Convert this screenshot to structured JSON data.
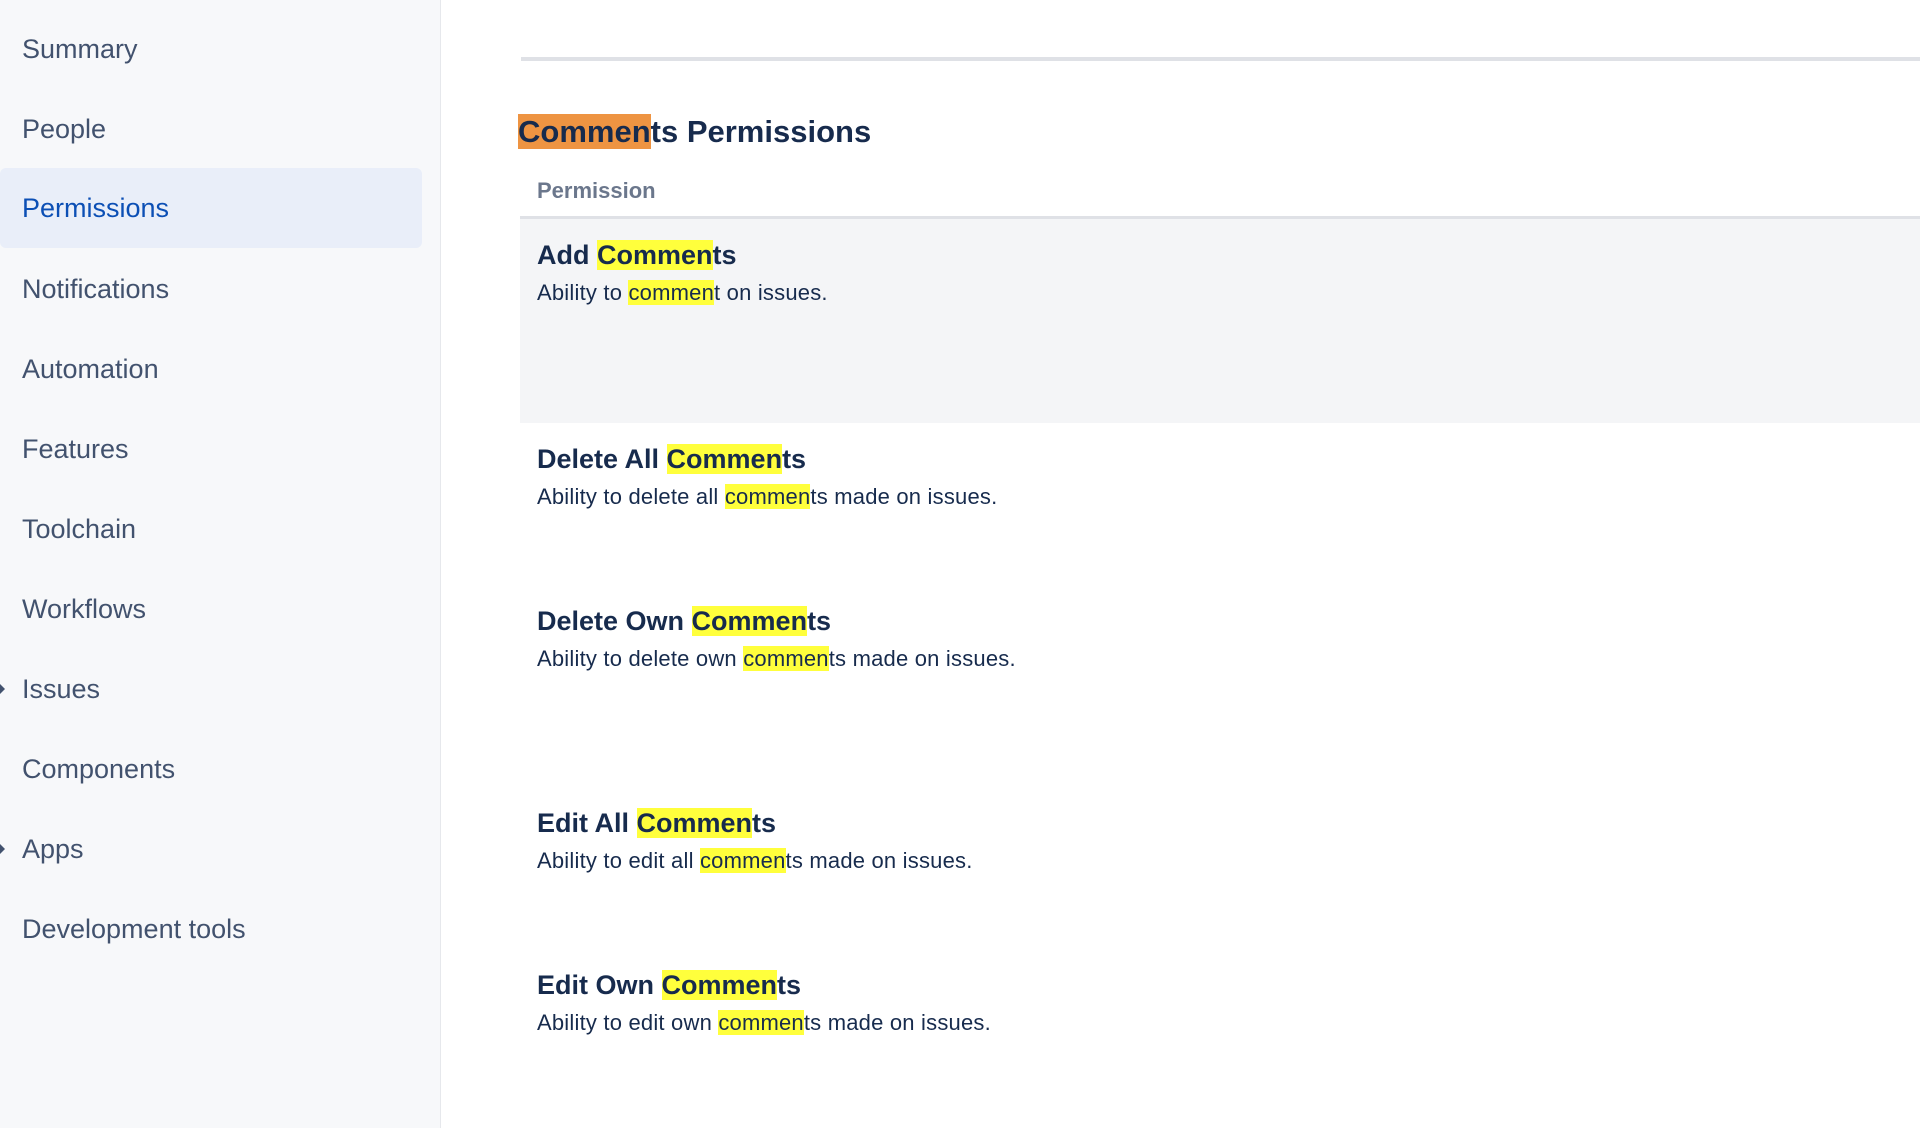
{
  "sidebar": {
    "items": [
      {
        "label": "Summary"
      },
      {
        "label": "People"
      },
      {
        "label": "Permissions",
        "active": true
      },
      {
        "label": "Notifications"
      },
      {
        "label": "Automation"
      },
      {
        "label": "Features"
      },
      {
        "label": "Toolchain"
      },
      {
        "label": "Workflows"
      },
      {
        "label": "Issues",
        "expandable": true
      },
      {
        "label": "Components"
      },
      {
        "label": "Apps",
        "expandable": true
      },
      {
        "label": "Development tools"
      }
    ]
  },
  "main": {
    "section": {
      "title_match": "Commen",
      "title_rest": "ts Permissions"
    },
    "table": {
      "column_header": "Permission",
      "rows": [
        {
          "name_before": "Add ",
          "name_match": "Commen",
          "name_after": "ts",
          "desc_before": "Ability to ",
          "desc_match": "commen",
          "desc_after": "t on issues."
        },
        {
          "name_before": "Delete All ",
          "name_match": "Commen",
          "name_after": "ts",
          "desc_before": "Ability to delete all ",
          "desc_match": "commen",
          "desc_after": "ts made on issues."
        },
        {
          "name_before": "Delete Own ",
          "name_match": "Commen",
          "name_after": "ts",
          "desc_before": "Ability to delete own ",
          "desc_match": "commen",
          "desc_after": "ts made on issues."
        },
        {
          "name_before": "Edit All ",
          "name_match": "Commen",
          "name_after": "ts",
          "desc_before": "Ability to edit all ",
          "desc_match": "commen",
          "desc_after": "ts made on issues."
        },
        {
          "name_before": "Edit Own ",
          "name_match": "Commen",
          "name_after": "ts",
          "desc_before": "Ability to edit own ",
          "desc_match": "commen",
          "desc_after": "ts made on issues."
        }
      ]
    }
  },
  "colors": {
    "find_highlight": "#ffff3c",
    "current_find_highlight": "#ee9442",
    "active_nav_bg": "#e9eef9",
    "active_nav_text": "#0c4fb5"
  }
}
